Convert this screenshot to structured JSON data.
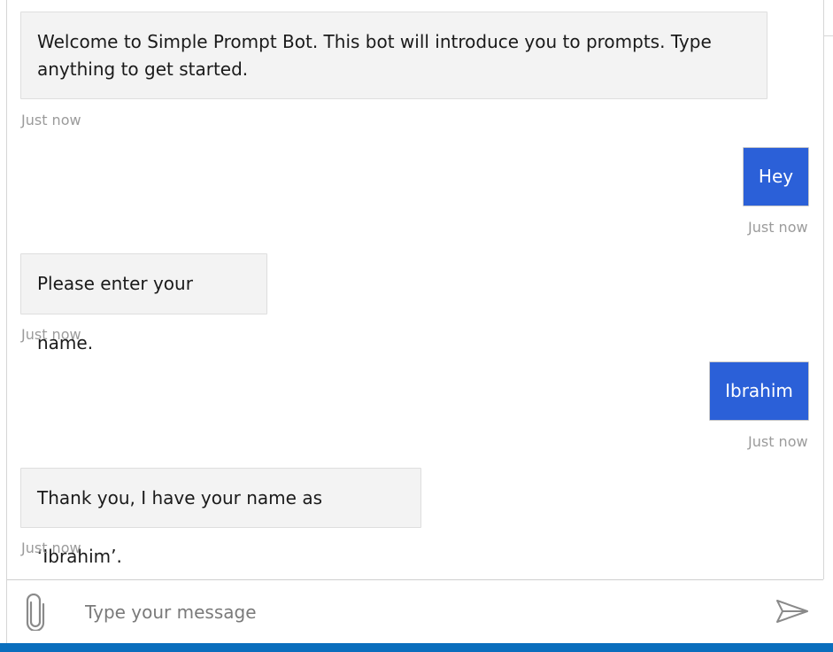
{
  "transcript": {
    "messages": [
      {
        "from": "bot",
        "text": "Welcome to Simple Prompt Bot. This bot will introduce you to prompts. Type anything to get started.",
        "time": "Just now"
      },
      {
        "from": "user",
        "text": "Hey",
        "time": "Just now"
      },
      {
        "from": "bot",
        "text": "Please enter your name.",
        "time": "Just now"
      },
      {
        "from": "user",
        "text": "Ibrahim",
        "time": "Just now"
      },
      {
        "from": "bot",
        "text": "Thank you, I have your name as ‘Ibrahim’.",
        "time": "Just now"
      }
    ]
  },
  "composer": {
    "placeholder": "Type your message",
    "attach_icon": "paperclip-icon",
    "send_icon": "send-icon"
  },
  "colors": {
    "user_bubble": "#2b60d8",
    "bot_bubble": "#f3f3f3",
    "accent_bar": "#0a6ebd"
  }
}
